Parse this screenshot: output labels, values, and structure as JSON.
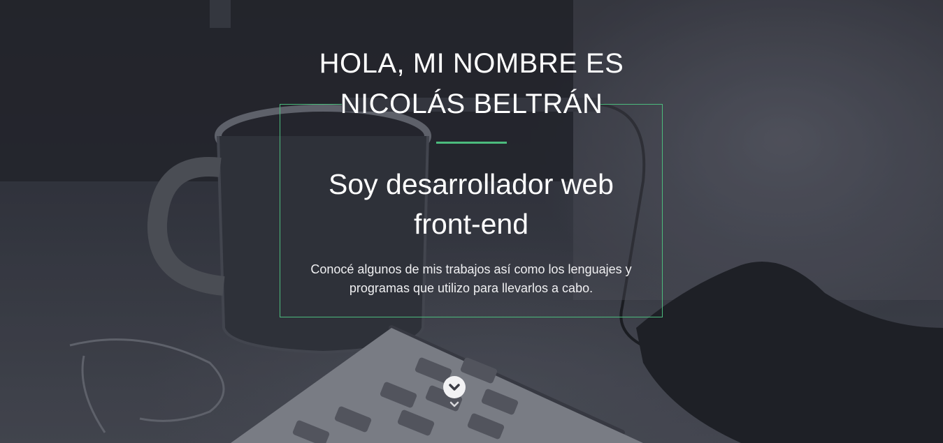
{
  "hero": {
    "title_line1": "HOLA, MI NOMBRE ES",
    "title_line2": "NICOLÁS BELTRÁN",
    "subtitle_line1": "Soy desarrollador web",
    "subtitle_line2": "front-end",
    "description_line1": "Conocé algunos de mis trabajos así como los lenguajes y",
    "description_line2": "programas que utilizo para llevarlos a cabo.",
    "scroll_icon": "chevron-down-icon",
    "accent_color": "#4cbb7d"
  }
}
